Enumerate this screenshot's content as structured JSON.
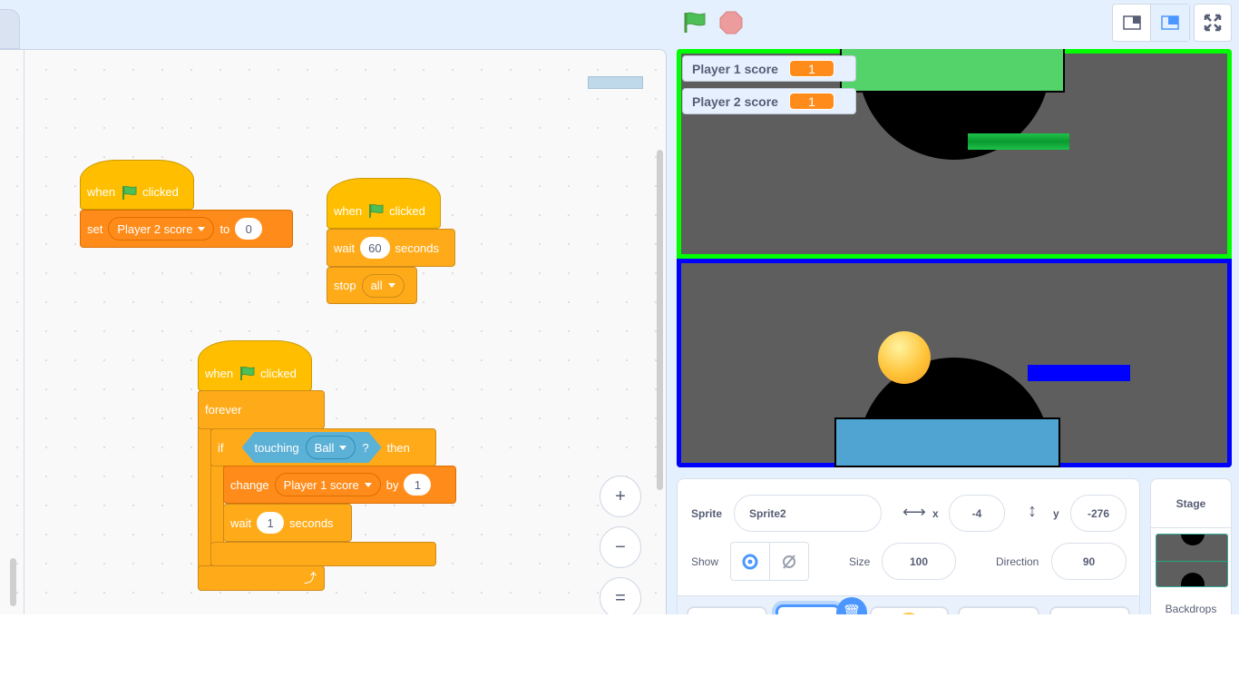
{
  "header": {
    "green_flag": "green-flag-icon",
    "stop": "stop-icon",
    "layout_buttons": [
      "small-stage",
      "normal-stage",
      "fullscreen"
    ]
  },
  "scripts": [
    {
      "hat": {
        "when": "when",
        "clicked": "clicked"
      },
      "set": {
        "label": "set",
        "variable": "Player 2 score",
        "to": "to",
        "value": "0"
      }
    },
    {
      "hat": {
        "when": "when",
        "clicked": "clicked"
      },
      "wait": {
        "label": "wait",
        "value": "60",
        "unit": "seconds"
      },
      "stop": {
        "label": "stop",
        "option": "all"
      }
    },
    {
      "hat": {
        "when": "when",
        "clicked": "clicked"
      },
      "forever": "forever",
      "if": {
        "label": "if",
        "touching": "touching",
        "object": "Ball",
        "q": "?",
        "then": "then"
      },
      "change": {
        "label": "change",
        "variable": "Player 1 score",
        "by": "by",
        "value": "1"
      },
      "wait": {
        "label": "wait",
        "value": "1",
        "unit": "seconds"
      }
    }
  ],
  "zoom": {
    "in": "+",
    "out": "−",
    "reset": "="
  },
  "stage": {
    "monitors": [
      {
        "label": "Player 1 score",
        "value": "1"
      },
      {
        "label": "Player 2 score",
        "value": "1"
      }
    ]
  },
  "sprite_info": {
    "sprite_label": "Sprite",
    "sprite_name": "Sprite2",
    "x_label": "x",
    "x": "-4",
    "y_label": "y",
    "y": "-276",
    "show_label": "Show",
    "size_label": "Size",
    "size": "100",
    "direction_label": "Direction",
    "direction": "90"
  },
  "stage_panel": {
    "title": "Stage",
    "backdrops_label": "Backdrops"
  },
  "colors": {
    "events": "#ffbf00",
    "control": "#ffab19",
    "variables": "#ff8c1a",
    "sensing": "#5cb1d6",
    "stage_bg": "#5e5e5e"
  }
}
